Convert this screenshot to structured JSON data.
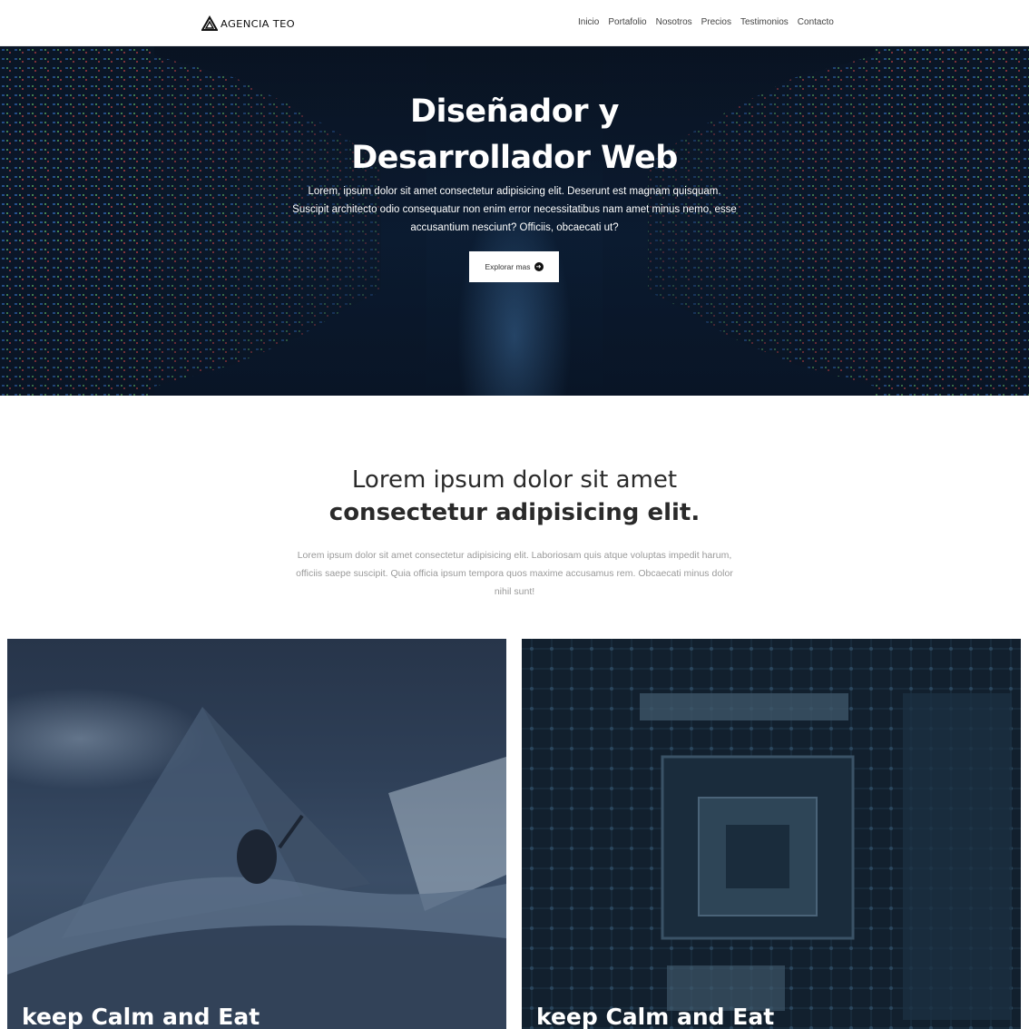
{
  "header": {
    "logo_text": "AGENCIA TEO",
    "nav": [
      "Inicio",
      "Portafolio",
      "Nosotros",
      "Precios",
      "Testimonios",
      "Contacto"
    ]
  },
  "hero": {
    "title": "Diseñador y Desarrollador Web",
    "text": "Lorem, ipsum dolor sit amet consectetur adipisicing elit. Deserunt est magnam quisquam. Suscipit architecto odio consequatur non enim error necessitatibus nam amet minus nemo, esse accusantium nesciunt? Officiis, obcaecati ut?",
    "button_label": "Explorar mas",
    "button_icon": "arrow-right-circle-icon"
  },
  "intro": {
    "heading_light": "Lorem ipsum dolor sit amet",
    "heading_bold": "consectetur adipisicing elit.",
    "text": "Lorem ipsum dolor sit amet consectetur adipisicing elit. Laboriosam quis atque voluptas impedit harum, officiis saepe suscipit. Quia officia ipsum tempora quos maxime accusamus rem. Obcaecati minus dolor nihil sunt!"
  },
  "cards": [
    {
      "caption": "keep Calm and Eat"
    },
    {
      "caption": "keep Calm and Eat"
    }
  ],
  "colors": {
    "header_bg": "#ffffff",
    "hero_dark": "#0d2038",
    "text_dark": "#2a2a2a",
    "text_muted": "#9a9a9a",
    "button_bg": "#ffffff"
  }
}
